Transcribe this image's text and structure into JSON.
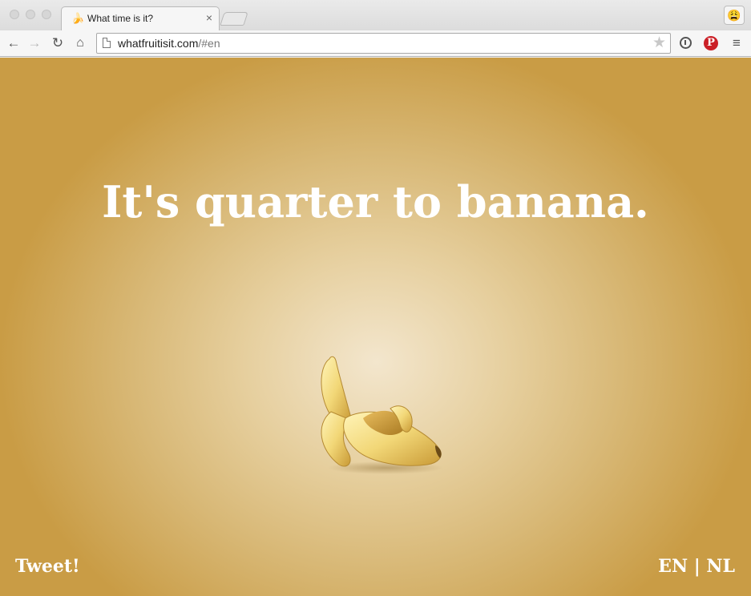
{
  "browser": {
    "tab": {
      "title": "What time is it?",
      "favicon": "🍌",
      "close": "×"
    },
    "profile_icon": "😩",
    "nav": {
      "back": "←",
      "forward": "→",
      "reload": "↻",
      "home": "⌂"
    },
    "address": {
      "host": "whatfruitisit.com",
      "path": "/#en"
    },
    "star": "★",
    "menu": "≡",
    "pinterest": "P"
  },
  "page": {
    "headline": "It's quarter to banana.",
    "tweet": "Tweet!",
    "lang_en": "EN",
    "lang_sep": "|",
    "lang_nl": "NL"
  },
  "colors": {
    "background_center": "#f3e6cd",
    "background_edge": "#c99c45",
    "text": "#ffffff",
    "pinterest": "#cb2027"
  }
}
